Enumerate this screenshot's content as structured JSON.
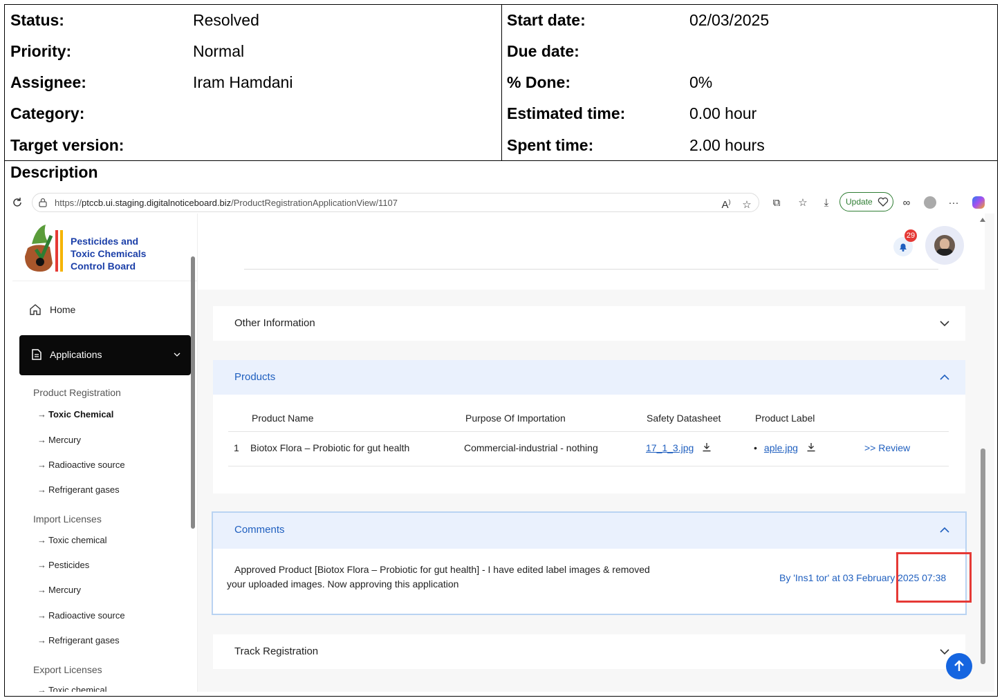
{
  "issue": {
    "left_fields": [
      {
        "label": "Status:",
        "value": "Resolved"
      },
      {
        "label": "Priority:",
        "value": "Normal"
      },
      {
        "label": "Assignee:",
        "value": "Iram Hamdani"
      },
      {
        "label": "Category:",
        "value": ""
      },
      {
        "label": "Target version:",
        "value": ""
      }
    ],
    "right_fields": [
      {
        "label": "Start date:",
        "value": "02/03/2025"
      },
      {
        "label": "Due date:",
        "value": ""
      },
      {
        "label": "% Done:",
        "value": "0%"
      },
      {
        "label": "Estimated time:",
        "value": "0.00 hour"
      },
      {
        "label": "Spent time:",
        "value": "2.00 hours"
      }
    ],
    "description_title": "Description"
  },
  "browser": {
    "url_scheme": "https://",
    "url_host": "ptccb.ui.staging.digitalnoticeboard.biz",
    "url_path": "/ProductRegistrationApplicationView/1107",
    "update_label": "Update",
    "icons": [
      "reload-icon",
      "lock-icon",
      "read-aloud-icon",
      "favorite-star-icon",
      "extensions-icon",
      "favorites-icon",
      "downloads-icon",
      "heart-pulse-icon",
      "copilot-icon",
      "profile-icon",
      "more-icon",
      "edge-copilot-icon"
    ]
  },
  "sidebar": {
    "logo_lines": [
      "Pesticides and",
      "Toxic Chemicals",
      "Control Board"
    ],
    "home_label": "Home",
    "applications_label": "Applications",
    "groups": [
      {
        "title": "Product Registration",
        "items": [
          "Toxic Chemical",
          "Mercury",
          "Radioactive source",
          "Refrigerant gases"
        ]
      },
      {
        "title": "Import Licenses",
        "items": [
          "Toxic chemical",
          "Pesticides",
          "Mercury",
          "Radioactive source",
          "Refrigerant gases"
        ]
      },
      {
        "title": "Export Licenses",
        "items": [
          "Toxic chemical"
        ]
      }
    ]
  },
  "header": {
    "notification_count": "29"
  },
  "panels": {
    "other_information": "Other Information",
    "products": {
      "title": "Products",
      "columns": [
        "Product Name",
        "Purpose Of Importation",
        "Safety Datasheet",
        "Product Label"
      ],
      "rows": [
        {
          "index": "1",
          "name": "Biotox Flora – Probiotic for gut health",
          "purpose": "Commercial-industrial - nothing",
          "datasheet": "17_1_3.jpg",
          "label_file": "aple.jpg",
          "review": ">> Review"
        }
      ]
    },
    "comments": {
      "title": "Comments",
      "text_line1": "Approved Product [Biotox Flora – Probiotic for gut health] - I have edited label images & removed",
      "text_line2": "your uploaded images. Now approving this application",
      "meta": "By 'Ins1 tor' at 03 February 2025 07:38"
    },
    "track_registration": "Track Registration"
  },
  "colors": {
    "accent": "#1f5fbf",
    "highlight_box": "#e53935",
    "badge": "#e53935",
    "fab": "#1565e0"
  }
}
